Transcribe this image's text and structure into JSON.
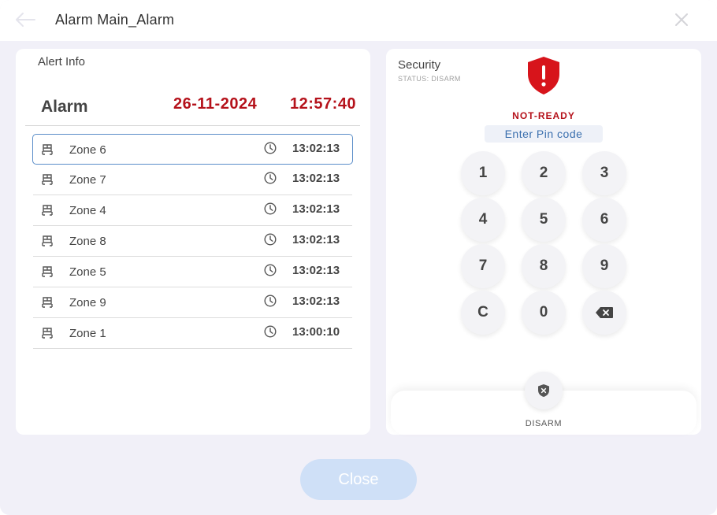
{
  "header": {
    "title": "Alarm Main_Alarm",
    "back_icon": "arrow-left-icon",
    "close_icon": "close-icon"
  },
  "alert_info": {
    "label": "Alert Info",
    "alarm_title": "Alarm",
    "date": "26-11-2024",
    "time": "12:57:40",
    "zones": [
      {
        "name": "Zone 6",
        "time": "13:02:13",
        "selected": true
      },
      {
        "name": "Zone 7",
        "time": "13:02:13",
        "selected": false
      },
      {
        "name": "Zone 4",
        "time": "13:02:13",
        "selected": false
      },
      {
        "name": "Zone 8",
        "time": "13:02:13",
        "selected": false
      },
      {
        "name": "Zone 5",
        "time": "13:02:13",
        "selected": false
      },
      {
        "name": "Zone 9",
        "time": "13:02:13",
        "selected": false
      },
      {
        "name": "Zone 1",
        "time": "13:00:10",
        "selected": false
      }
    ]
  },
  "security": {
    "label": "Security",
    "status": "STATUS: DISARM",
    "state": "NOT-READY",
    "pin_placeholder": "Enter Pin code",
    "keys": [
      "1",
      "2",
      "3",
      "4",
      "5",
      "6",
      "7",
      "8",
      "9",
      "C",
      "0"
    ],
    "backspace_icon": "backspace-icon",
    "disarm_label": "DISARM"
  },
  "footer": {
    "close_label": "Close"
  },
  "colors": {
    "alarm_red": "#b5121b",
    "accent_blue": "#5b8ec9",
    "close_button": "#cfe0f7"
  }
}
